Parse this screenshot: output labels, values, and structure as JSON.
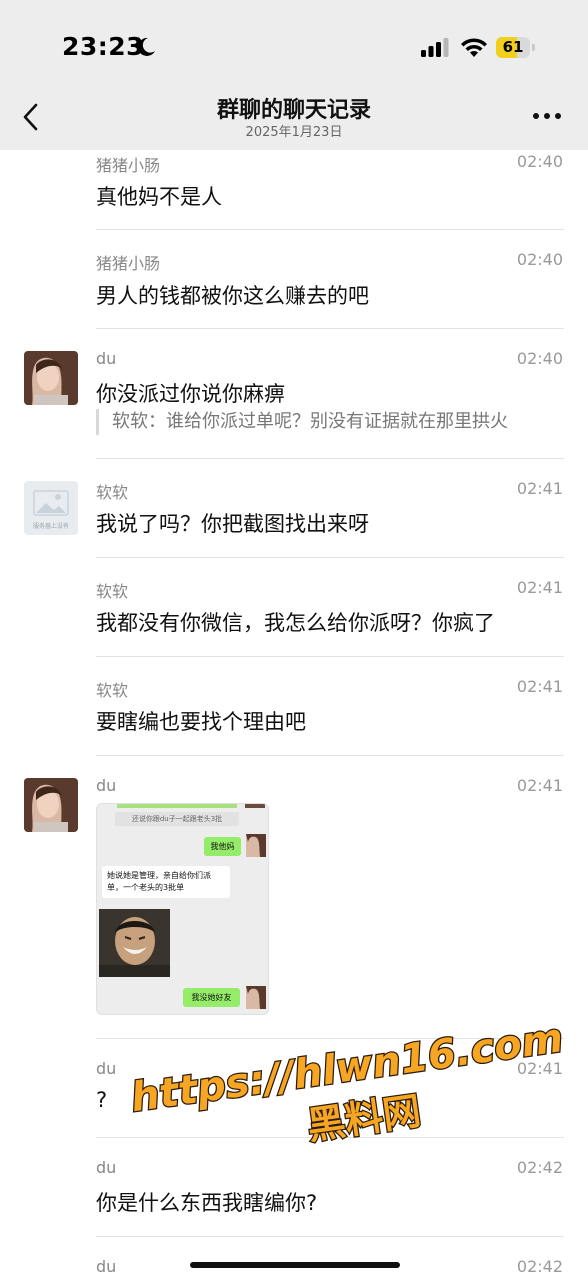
{
  "status_bar": {
    "time": "23:23",
    "battery": "61",
    "battery_level": 0.61
  },
  "nav": {
    "title": "群聊的聊天记录",
    "date": "2025年1月23日"
  },
  "messages": [
    {
      "sender": "猪猪小肠",
      "time": "02:40",
      "text": "真他妈不是人"
    },
    {
      "sender": "猪猪小肠",
      "time": "02:40",
      "text": "男人的钱都被你这么赚去的吧"
    },
    {
      "sender": "du",
      "time": "02:40",
      "text": "你没派过你说你麻痹",
      "quote": "软软：谁给你派过单呢？别没有证据就在那里拱火"
    },
    {
      "sender": "软软",
      "time": "02:41",
      "text": "我说了吗？你把截图找出来呀"
    },
    {
      "sender": "软软",
      "time": "02:41",
      "text": "我都没有你微信，我怎么给你派呀？你疯了"
    },
    {
      "sender": "软软",
      "time": "02:41",
      "text": "要瞎编也要找个理由吧"
    },
    {
      "sender": "du",
      "time": "02:41"
    },
    {
      "sender": "du",
      "time": "02:41",
      "text": "?"
    },
    {
      "sender": "du",
      "time": "02:42",
      "text": "你是什么东西我瞎编你?"
    },
    {
      "sender": "du",
      "time": "02:42"
    }
  ],
  "placeholder_avatar": {
    "caption": "服务器上没有"
  },
  "screenshot": {
    "quote_top": "还说你跟du子一起跟老头3批",
    "reply1": "我他妈",
    "left_msg": "她说她是管理，亲自给你们派单，一个老头的3批单",
    "reply2": "我没她好友"
  },
  "watermark": {
    "url": "https://hlwn16.com",
    "name": "黑料网"
  },
  "colors": {
    "header_bg": "#ededed",
    "wechat_green": "#95ec69",
    "watermark_fill": "#f6a623"
  }
}
